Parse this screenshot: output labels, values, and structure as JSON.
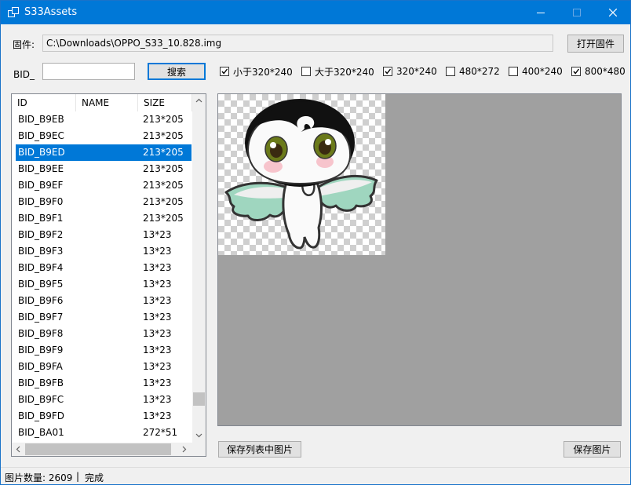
{
  "window": {
    "title": "S33Assets"
  },
  "firmware": {
    "label": "固件:",
    "path": "C:\\Downloads\\OPPO_S33_10.828.img",
    "open_button": "打开固件"
  },
  "search": {
    "label": "BID_",
    "value": "",
    "button": "搜索"
  },
  "filters": [
    {
      "label": "小于320*240",
      "checked": true
    },
    {
      "label": "大于320*240",
      "checked": false
    },
    {
      "label": "320*240",
      "checked": true
    },
    {
      "label": "480*272",
      "checked": false
    },
    {
      "label": "400*240",
      "checked": false
    },
    {
      "label": "800*480",
      "checked": true
    }
  ],
  "table": {
    "columns": [
      "ID",
      "NAME",
      "SIZE"
    ],
    "rows": [
      {
        "id": "BID_B9EB",
        "name": "",
        "size": "213*205",
        "selected": false
      },
      {
        "id": "BID_B9EC",
        "name": "",
        "size": "213*205",
        "selected": false
      },
      {
        "id": "BID_B9ED",
        "name": "",
        "size": "213*205",
        "selected": true
      },
      {
        "id": "BID_B9EE",
        "name": "",
        "size": "213*205",
        "selected": false
      },
      {
        "id": "BID_B9EF",
        "name": "",
        "size": "213*205",
        "selected": false
      },
      {
        "id": "BID_B9F0",
        "name": "",
        "size": "213*205",
        "selected": false
      },
      {
        "id": "BID_B9F1",
        "name": "",
        "size": "213*205",
        "selected": false
      },
      {
        "id": "BID_B9F2",
        "name": "",
        "size": "13*23",
        "selected": false
      },
      {
        "id": "BID_B9F3",
        "name": "",
        "size": "13*23",
        "selected": false
      },
      {
        "id": "BID_B9F4",
        "name": "",
        "size": "13*23",
        "selected": false
      },
      {
        "id": "BID_B9F5",
        "name": "",
        "size": "13*23",
        "selected": false
      },
      {
        "id": "BID_B9F6",
        "name": "",
        "size": "13*23",
        "selected": false
      },
      {
        "id": "BID_B9F7",
        "name": "",
        "size": "13*23",
        "selected": false
      },
      {
        "id": "BID_B9F8",
        "name": "",
        "size": "13*23",
        "selected": false
      },
      {
        "id": "BID_B9F9",
        "name": "",
        "size": "13*23",
        "selected": false
      },
      {
        "id": "BID_B9FA",
        "name": "",
        "size": "13*23",
        "selected": false
      },
      {
        "id": "BID_B9FB",
        "name": "",
        "size": "13*23",
        "selected": false
      },
      {
        "id": "BID_B9FC",
        "name": "",
        "size": "13*23",
        "selected": false
      },
      {
        "id": "BID_B9FD",
        "name": "",
        "size": "13*23",
        "selected": false
      },
      {
        "id": "BID_BA01",
        "name": "",
        "size": "272*51",
        "selected": false
      }
    ]
  },
  "actions": {
    "save_list": "保存列表中图片",
    "save_image": "保存图片"
  },
  "status": {
    "count": "图片数量: 2609",
    "separator": "|",
    "state": "完成"
  },
  "colors": {
    "accent": "#0078d7",
    "preview_bg": "#a0a0a0"
  },
  "icons": {
    "app": "window-icon",
    "minimize": "minimize-icon",
    "maximize": "maximize-icon",
    "close": "close-icon",
    "check": "check-icon"
  }
}
